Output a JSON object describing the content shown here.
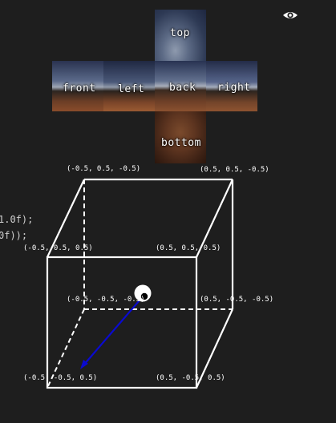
{
  "cube_map": {
    "faces": [
      {
        "id": "top",
        "label": "top"
      },
      {
        "id": "front",
        "label": "front"
      },
      {
        "id": "left",
        "label": "left"
      },
      {
        "id": "back",
        "label": "back"
      },
      {
        "id": "right",
        "label": "right"
      },
      {
        "id": "bottom",
        "label": "bottom"
      }
    ]
  },
  "toolbar": {
    "icon": "eye-icon"
  },
  "code_fragments": [
    "1.0f);",
    "0f));"
  ],
  "vertices": [
    {
      "id": "v-back-top-left",
      "label": "(-0.5, 0.5, -0.5)"
    },
    {
      "id": "v-back-top-right",
      "label": "(0.5, 0.5, -0.5)"
    },
    {
      "id": "v-front-top-left",
      "label": "(-0.5, 0.5, 0.5)"
    },
    {
      "id": "v-front-top-right",
      "label": "(0.5, 0.5, 0.5)"
    },
    {
      "id": "v-back-bottom-left",
      "label": "(-0.5, -0.5, -0.5)"
    },
    {
      "id": "v-back-bottom-right",
      "label": "(0.5, -0.5, -0.5)"
    },
    {
      "id": "v-front-bottom-left",
      "label": "(-0.5, -0.5, 0.5)"
    },
    {
      "id": "v-front-bottom-right",
      "label": "(0.5, -0.5, 0.5)"
    }
  ],
  "colors": {
    "background": "#1e1e1e",
    "edge": "#ffffff",
    "direction_vector": "#0a0ad0",
    "sky": "#4a5a7a",
    "ground": "#6a3c24"
  }
}
